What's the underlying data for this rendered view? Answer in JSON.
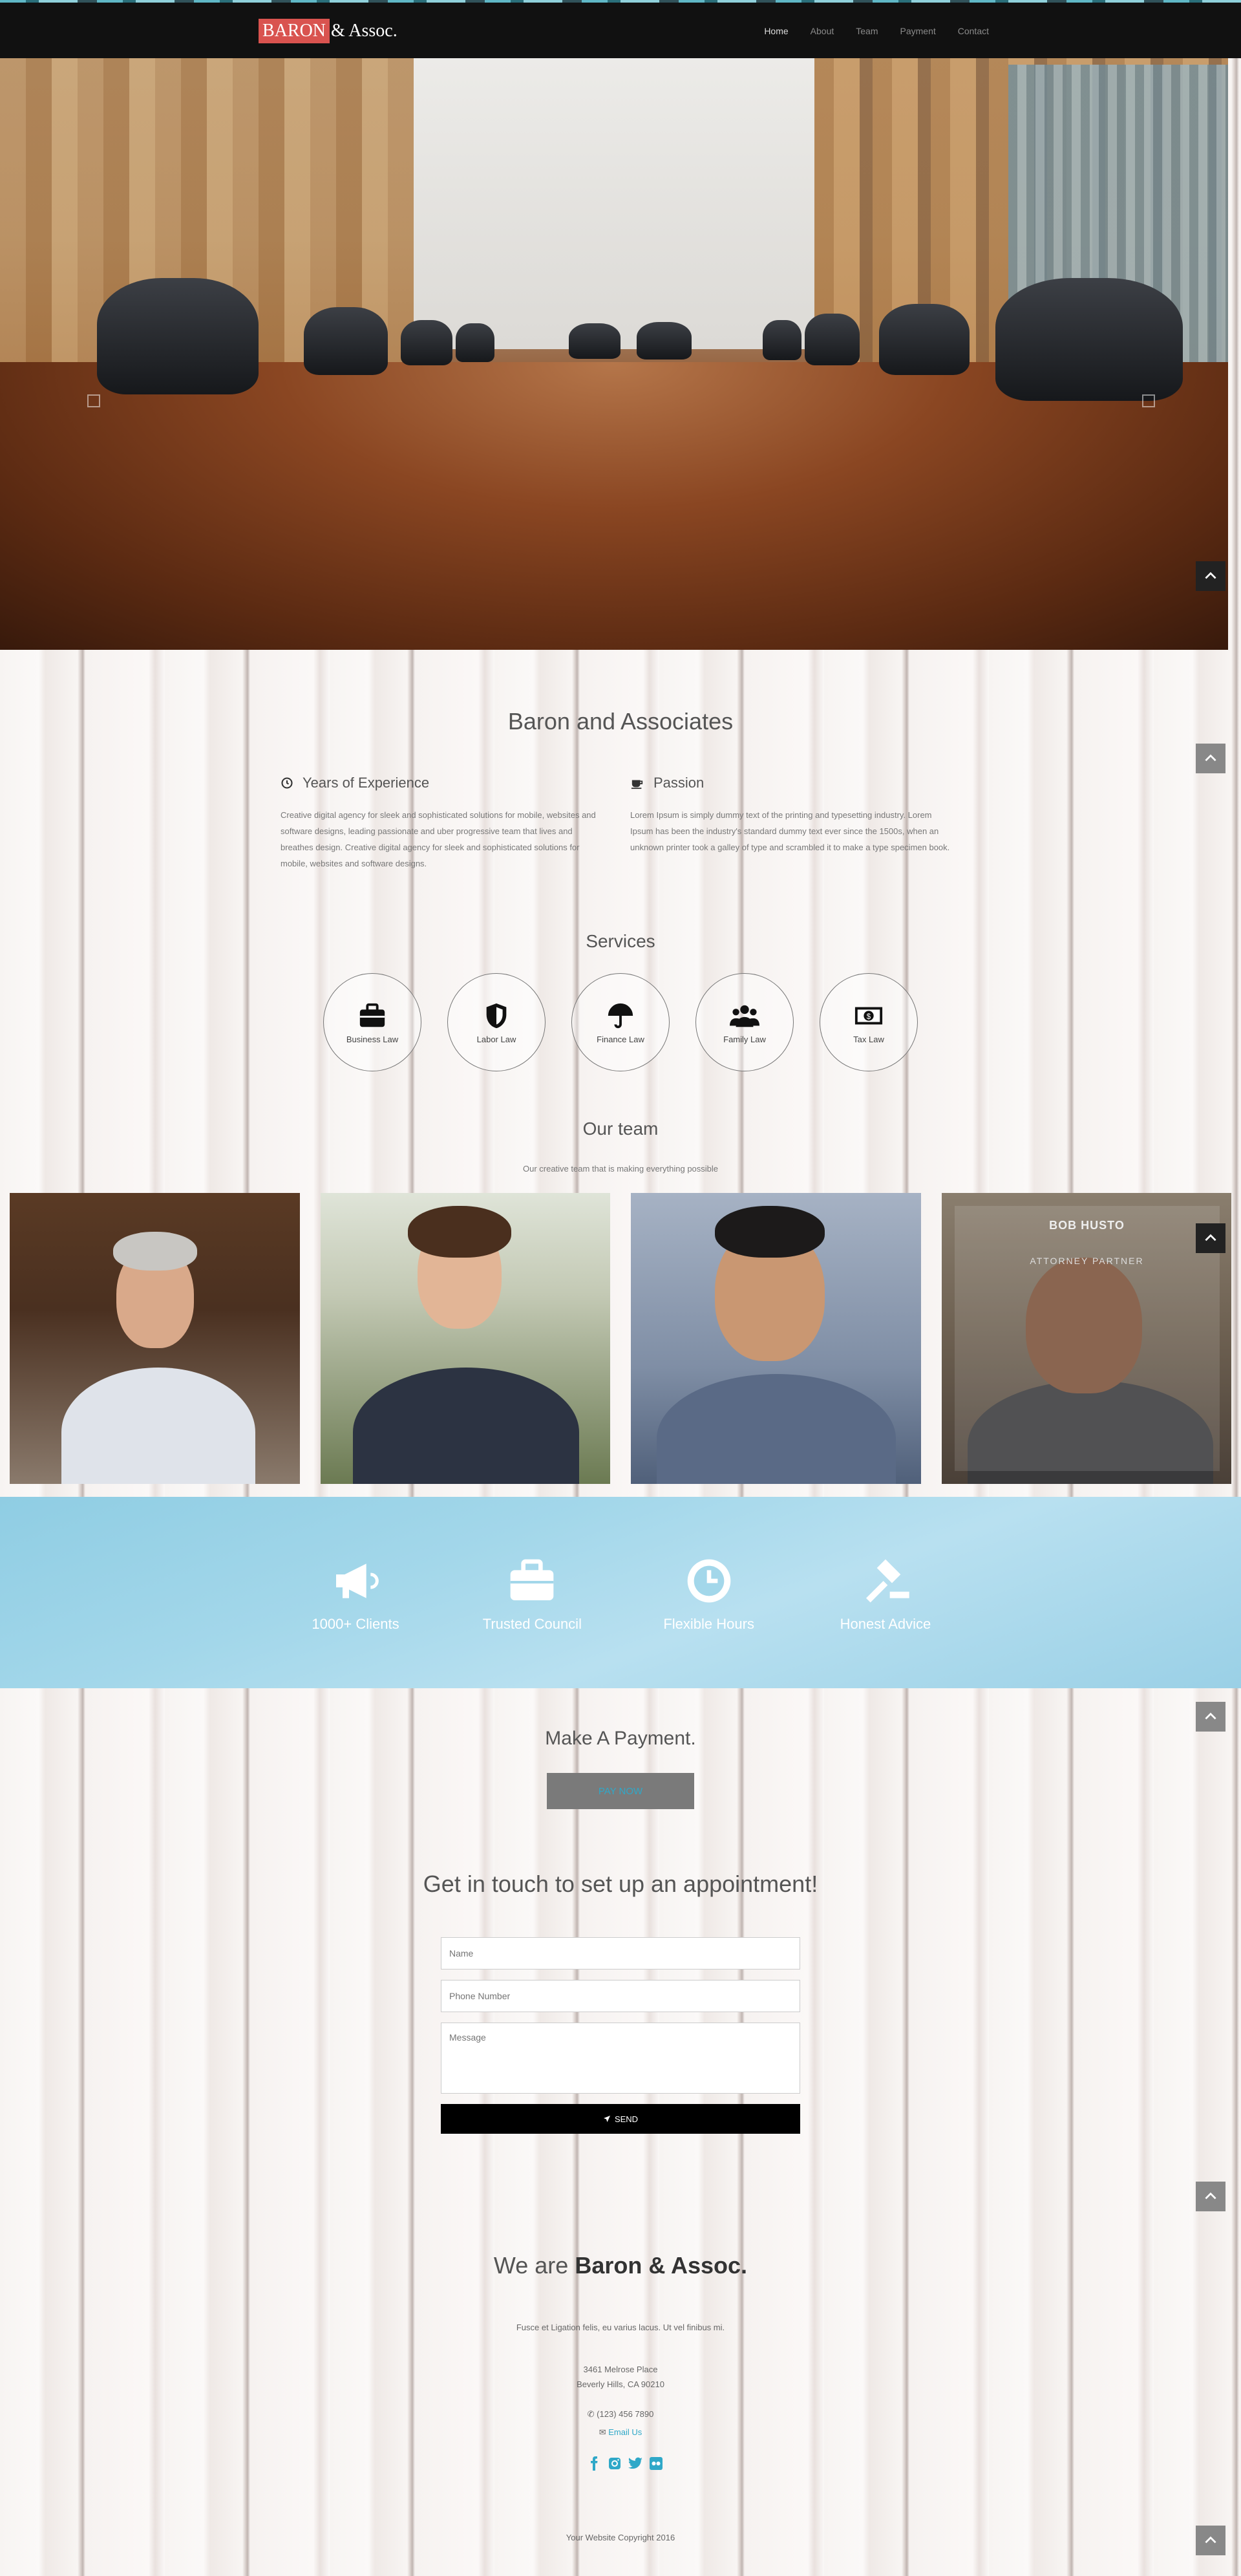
{
  "brand": {
    "highlight": "BARON",
    "rest": "& Assoc."
  },
  "nav": [
    "Home",
    "About",
    "Team",
    "Payment",
    "Contact"
  ],
  "about": {
    "title": "Baron and Associates",
    "col1": {
      "heading": "Years of Experience",
      "text": "Creative digital agency for sleek and sophisticated solutions for mobile, websites and software designs, leading passionate and uber progressive team that lives and breathes design. Creative digital agency for sleek and sophisticated solutions for mobile, websites and software designs."
    },
    "col2": {
      "heading": "Passion",
      "text": "Lorem Ipsum is simply dummy text of the printing and typesetting industry. Lorem Ipsum has been the industry's standard dummy text ever since the 1500s, when an unknown printer took a galley of type and scrambled it to make a type specimen book."
    }
  },
  "services": {
    "title": "Services",
    "items": [
      "Business Law",
      "Labor Law",
      "Finance Law",
      "Family Law",
      "Tax Law"
    ]
  },
  "team": {
    "title": "Our team",
    "subtitle": "Our creative team that is making everything possible",
    "overlay_name": "BOB HUSTO",
    "overlay_role": "ATTORNEY PARTNER"
  },
  "features": [
    "1000+ Clients",
    "Trusted Council",
    "Flexible Hours",
    "Honest Advice"
  ],
  "payment": {
    "title": "Make A Payment.",
    "button": "PAY NOW"
  },
  "contact": {
    "title": "Get in touch to set up an appointment!",
    "name_placeholder": "Name",
    "phone_placeholder": "Phone Number",
    "message_placeholder": "Message",
    "send": "SEND"
  },
  "footer": {
    "title_prefix": "We are",
    "title_bold": "Baron & Assoc.",
    "tagline": "Fusce et Ligation felis, eu varius lacus. Ut vel finibus mi.",
    "address1": "3461 Melrose Place",
    "address2": "Beverly Hills, CA 90210",
    "phone": "(123) 456 7890",
    "email": "Email Us",
    "copyright": "Your Website Copyright 2016"
  },
  "colors": {
    "accent": "#2fa8c8",
    "brand_red": "#d9534f",
    "navbar": "#111111",
    "features_bg": "#a3d7ea"
  }
}
